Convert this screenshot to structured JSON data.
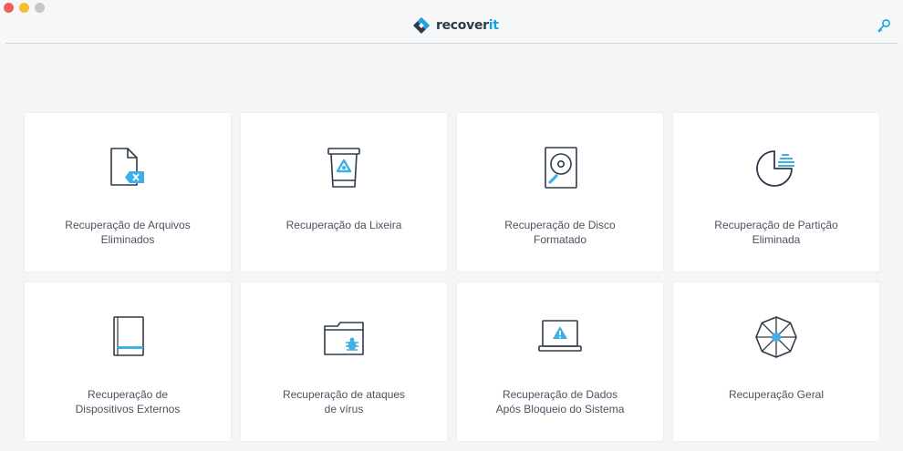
{
  "app": {
    "brand_prefix": "recover",
    "brand_suffix": "it",
    "icons": {
      "logo": "recoverit-logo-icon",
      "key": "key-icon"
    },
    "colors": {
      "accent": "#1aa3e0",
      "text": "#2f3a48"
    }
  },
  "cards": [
    {
      "line1": "Recuperação de Arquivos",
      "line2": "Eliminados",
      "icon": "deleted-file-icon"
    },
    {
      "line1": "Recuperação da Lixeira",
      "line2": "",
      "icon": "recycle-bin-icon"
    },
    {
      "line1": "Recuperação de Disco",
      "line2": "Formatado",
      "icon": "formatted-disk-icon"
    },
    {
      "line1": "Recuperação de Partição",
      "line2": "Eliminada",
      "icon": "partition-icon"
    },
    {
      "line1": "Recuperação de",
      "line2": "Dispositivos Externos",
      "icon": "external-device-icon"
    },
    {
      "line1": "Recuperação de ataques",
      "line2": "de vírus",
      "icon": "virus-folder-icon"
    },
    {
      "line1": "Recuperação de Dados",
      "line2": "Após Bloqueio do Sistema",
      "icon": "crashed-system-icon"
    },
    {
      "line1": "Recuperação Geral",
      "line2": "",
      "icon": "all-around-recovery-icon"
    }
  ]
}
